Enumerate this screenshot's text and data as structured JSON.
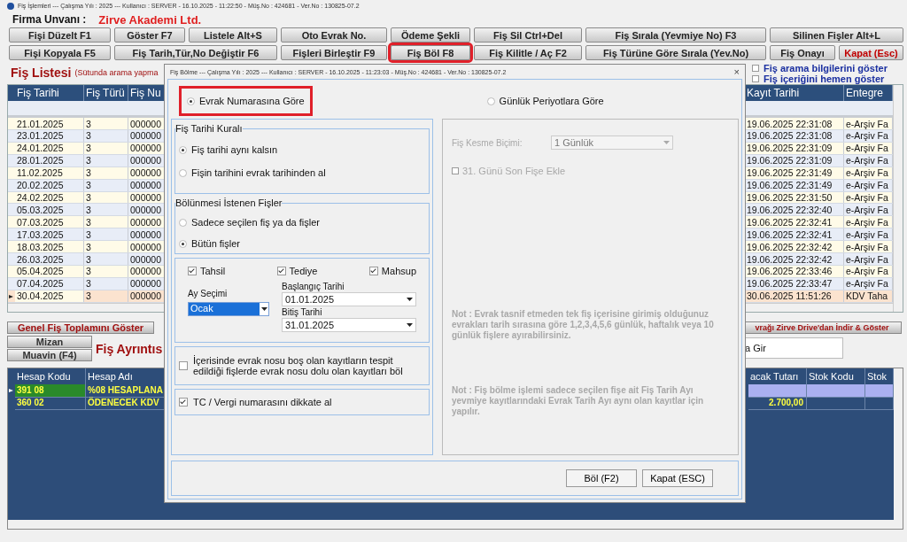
{
  "window": {
    "title": "Fiş İşlemleri  ---  Çalışma Yılı : 2025  ---  Kullanıcı : SERVER - 16.10.2025 - 11:22:50 - Müş.No : 424681 - Ver.No : 130825-07.2"
  },
  "company": {
    "label": "Firma  Unvanı :",
    "value": "Zirve Akademi Ltd."
  },
  "toolbar_rows": [
    [
      {
        "label": "Fişi Düzelt F1",
        "selected": false,
        "kind": "normal"
      },
      {
        "label": "Göster F7",
        "selected": false,
        "kind": "normal"
      },
      {
        "label": "Listele Alt+S",
        "selected": false,
        "kind": "normal"
      },
      {
        "label": "Oto Evrak No.",
        "selected": false,
        "kind": "normal"
      },
      {
        "label": "Ödeme Şekli",
        "selected": false,
        "kind": "normal"
      },
      {
        "label": "Fiş Sil Ctrl+Del",
        "selected": false,
        "kind": "normal"
      },
      {
        "label": "Fiş Sırala (Yevmiye No) F3",
        "selected": false,
        "kind": "normal"
      },
      {
        "label": "Silinen Fişler Alt+L",
        "selected": false,
        "kind": "normal"
      }
    ],
    [
      {
        "label": "Fişi Kopyala F5",
        "selected": false,
        "kind": "normal"
      },
      {
        "label": "Fiş Tarih,Tür,No Değiştir F6",
        "selected": false,
        "kind": "normal"
      },
      {
        "label": "Fişleri Birleştir F9",
        "selected": false,
        "kind": "normal"
      },
      {
        "label": "Fiş Böl F8",
        "selected": true,
        "kind": "normal"
      },
      {
        "label": "Fiş Kilitle / Aç F2",
        "selected": false,
        "kind": "normal"
      },
      {
        "label": "Fiş Türüne Göre Sırala (Yev.No)",
        "selected": false,
        "kind": "normal"
      },
      {
        "label": "Fiş Onayı",
        "selected": false,
        "kind": "normal"
      },
      {
        "label": "Kapat (Esc)",
        "selected": false,
        "kind": "danger"
      }
    ]
  ],
  "list": {
    "title": "Fiş Listesi",
    "hint": "(Sütunda arama yapma",
    "options": [
      {
        "label": "Fiş arama bilgilerini göster",
        "checked": false
      },
      {
        "label": "Fiş içeriğini hemen göster",
        "checked": false
      }
    ]
  },
  "table": {
    "columns": [
      "Fiş Tarihi",
      "Fiş Türü",
      "Fiş Nu",
      "Kayıt Tarihi",
      "Entegre"
    ],
    "rows": [
      {
        "cells": [
          "21.01.2025",
          "3",
          "000000",
          "19.06.2025 22:31:08",
          "e-Arşiv Fa"
        ],
        "selected": false
      },
      {
        "cells": [
          "23.01.2025",
          "3",
          "000000",
          "19.06.2025 22:31:08",
          "e-Arşiv Fa"
        ],
        "selected": false
      },
      {
        "cells": [
          "24.01.2025",
          "3",
          "000000",
          "19.06.2025 22:31:09",
          "e-Arşiv Fa"
        ],
        "selected": false
      },
      {
        "cells": [
          "28.01.2025",
          "3",
          "000000",
          "19.06.2025 22:31:09",
          "e-Arşiv Fa"
        ],
        "selected": false
      },
      {
        "cells": [
          "11.02.2025",
          "3",
          "000000",
          "19.06.2025 22:31:49",
          "e-Arşiv Fa"
        ],
        "selected": false
      },
      {
        "cells": [
          "20.02.2025",
          "3",
          "000000",
          "19.06.2025 22:31:49",
          "e-Arşiv Fa"
        ],
        "selected": false
      },
      {
        "cells": [
          "24.02.2025",
          "3",
          "000000",
          "19.06.2025 22:31:50",
          "e-Arşiv Fa"
        ],
        "selected": false
      },
      {
        "cells": [
          "05.03.2025",
          "3",
          "000000",
          "19.06.2025 22:32:40",
          "e-Arşiv Fa"
        ],
        "selected": false
      },
      {
        "cells": [
          "07.03.2025",
          "3",
          "000000",
          "19.06.2025 22:32:41",
          "e-Arşiv Fa"
        ],
        "selected": false
      },
      {
        "cells": [
          "17.03.2025",
          "3",
          "000000",
          "19.06.2025 22:32:41",
          "e-Arşiv Fa"
        ],
        "selected": false
      },
      {
        "cells": [
          "18.03.2025",
          "3",
          "000000",
          "19.06.2025 22:32:42",
          "e-Arşiv Fa"
        ],
        "selected": false
      },
      {
        "cells": [
          "26.03.2025",
          "3",
          "000000",
          "19.06.2025 22:32:42",
          "e-Arşiv Fa"
        ],
        "selected": false
      },
      {
        "cells": [
          "05.04.2025",
          "3",
          "000000",
          "19.06.2025 22:33:46",
          "e-Arşiv Fa"
        ],
        "selected": false
      },
      {
        "cells": [
          "07.04.2025",
          "3",
          "000000",
          "19.06.2025 22:33:47",
          "e-Arşiv Fa"
        ],
        "selected": false
      },
      {
        "cells": [
          "30.04.2025",
          "3",
          "000000",
          "30.06.2025 11:51:26",
          "KDV Taha"
        ],
        "selected": true
      }
    ]
  },
  "actions": [
    "Genel Fiş Toplamını Göster",
    "Mizan",
    "Muavin (F4)"
  ],
  "details": {
    "title": "Fiş Ayrıntıs",
    "drive_button": "vrağı Zirve Drive'dan İndir & Göster",
    "field_value": "a Gir"
  },
  "detail_table": {
    "columns": [
      "Hesap Kodu",
      "Hesap Adı",
      "acak Tutarı",
      "Stok Kodu",
      "Stok"
    ],
    "rows": [
      {
        "code": "391 08",
        "name": "%08 HESAPLANA",
        "selected": true
      },
      {
        "code": "360 02",
        "name": "ÖDENECEK KDV",
        "amount": "2.700,00",
        "selected": false
      }
    ]
  },
  "dialog": {
    "title": "Fiş Bölme  ---  Çalışma Yılı : 2025  ---  Kullanıcı : SERVER - 16.10.2025 - 11:23:03 - Müş.No : 424681 - Ver.No : 130825-07.2",
    "close": "×",
    "modes": [
      {
        "label": "Evrak Numarasına Göre",
        "selected": true
      },
      {
        "label": "Günlük Periyotlara Göre",
        "selected": false
      }
    ],
    "date_rule": {
      "title": "Fiş Tarihi Kuralı",
      "options": [
        {
          "label": "Fiş tarihi aynı kalsın",
          "selected": true
        },
        {
          "label": "Fişin tarihini evrak tarihinden al",
          "selected": false
        }
      ]
    },
    "scope": {
      "title": "Bölünmesi İstenen Fişler",
      "options": [
        {
          "label": "Sadece seçilen fiş ya da fişler",
          "selected": false
        },
        {
          "label": "Bütün fişler",
          "selected": true
        }
      ]
    },
    "types": [
      {
        "label": "Tahsil",
        "checked": true
      },
      {
        "label": "Tediye",
        "checked": true
      },
      {
        "label": "Mahsup",
        "checked": true
      }
    ],
    "month": {
      "label": "Ay Seçimi",
      "value": "Ocak"
    },
    "start": {
      "label": "Başlangıç Tarihi",
      "value": "01.01.2025"
    },
    "end": {
      "label": "Bitiş Tarihi",
      "value": "31.01.2025"
    },
    "options": [
      {
        "label": "İçerisinde evrak nosu boş olan kayıtların tespit edildiği fişlerde evrak nosu dolu olan kayıtları böl",
        "checked": false
      },
      {
        "label": "TC / Vergi numarasını dikkate al",
        "checked": true
      }
    ],
    "period": {
      "disabled": true,
      "cut_label": "Fiş Kesme Biçimi:",
      "cut_value": "1 Günlük",
      "last_day": {
        "label": "31. Günü Son Fişe Ekle",
        "checked": false
      },
      "notes": [
        "Not : Evrak tasnif etmeden tek fiş içerisine girimiş olduğunuz evrakları tarih sırasına göre 1,2,3,4,5,6 günlük, haftalık veya 10 günlük fişlere ayırabilirsiniz.",
        "Not : Fiş bölme işlemi sadece seçilen fişe ait Fiş Tarih Ayı yevmiye kayıtlarındaki Evrak Tarih Ayı aynı olan kayıtlar için yapılır."
      ]
    },
    "buttons": [
      "Böl (F2)",
      "Kapat (ESC)"
    ]
  }
}
